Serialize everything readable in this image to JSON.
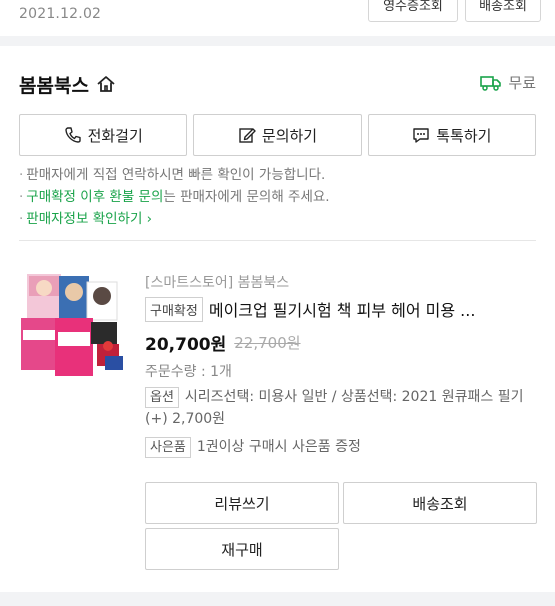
{
  "order": {
    "date": "2021.12.02",
    "top_buttons": [
      "영수증조회",
      "배송조회"
    ]
  },
  "seller": {
    "name": "봄봄북스",
    "shipping_label": "무료"
  },
  "contact": {
    "call": "전화걸기",
    "inquiry": "문의하기",
    "talk": "톡톡하기"
  },
  "notes": {
    "line1": "판매자에게 직접 연락하시면 빠른 확인이 가능합니다.",
    "line2_green": "구매확정 이후 환불 문의",
    "line2_rest": "는 판매자에게 문의해 주세요.",
    "line3_link": "판매자정보 확인하기"
  },
  "product": {
    "store": "[스마트스토어] 봄봄북스",
    "status_badge": "구매확정",
    "title": "메이크업 필기시험 책 피부 헤어 미용 ...",
    "price": "20,700원",
    "original_price": "22,700원",
    "quantity": "주문수량 : 1개",
    "option_tag": "옵션",
    "option_text": "시리즈선택: 미용사 일반 / 상품선택: 2021 원큐패스 필기 (+) 2,700원",
    "gift_tag": "사은품",
    "gift_text": "1권이상 구매시 사은품 증정"
  },
  "actions": {
    "review": "리뷰쓰기",
    "track": "배송조회",
    "rebuy": "재구매"
  },
  "colors": {
    "accent_green": "#1aa34a",
    "background": "#f2f3f5"
  },
  "icons": [
    "home-icon",
    "truck-icon",
    "phone-icon",
    "edit-icon",
    "chat-icon"
  ]
}
